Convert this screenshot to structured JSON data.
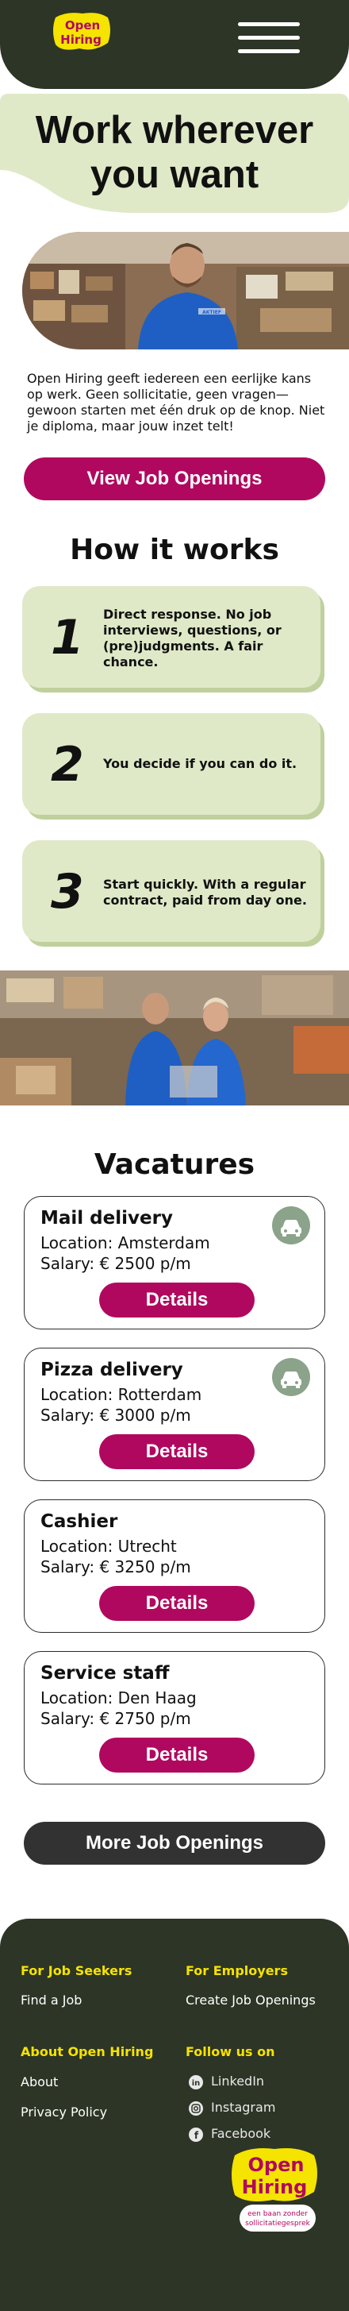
{
  "header": {
    "logo_line1": "Open",
    "logo_line2": "Hiring",
    "menu_icon": "hamburger-menu-icon"
  },
  "hero": {
    "title_line1": "Work wherever",
    "title_line2": "you want",
    "intro": "Open Hiring geeft iedereen een eerlijke kans op werk. Geen sollicitatie, geen vragen—gewoon starten met één druk op de knop. Niet je diploma, maar jouw inzet telt!",
    "cta_label": "View Job Openings",
    "shirt_text": "AKTIEF"
  },
  "how": {
    "title": "How it works",
    "steps": [
      {
        "num": "1",
        "text": "Direct response. No job interviews, questions, or (pre)judgments. A fair chance."
      },
      {
        "num": "2",
        "text": "You decide if you can do it."
      },
      {
        "num": "3",
        "text": "Start quickly. With a regular contract, paid from day one."
      }
    ]
  },
  "vacancies": {
    "title": "Vacatures",
    "items": [
      {
        "title": "Mail delivery",
        "location": "Location: Amsterdam",
        "salary": "Salary: € 2500 p/m",
        "button": "Details",
        "icon": "car-icon"
      },
      {
        "title": "Pizza delivery",
        "location": "Location: Rotterdam",
        "salary": "Salary: € 3000 p/m",
        "button": "Details",
        "icon": "car-icon"
      },
      {
        "title": "Cashier",
        "location": "Location: Utrecht",
        "salary": "Salary: € 3250 p/m",
        "button": "Details"
      },
      {
        "title": "Service staff",
        "location": "Location: Den Haag",
        "salary": "Salary: € 2750 p/m",
        "button": "Details"
      }
    ],
    "more_label": "More Job Openings"
  },
  "footer": {
    "seekers_head": "For Job Seekers",
    "seekers_link": "Find a Job",
    "employers_head": "For Employers",
    "employers_link": "Create Job Openings",
    "about_head": "About Open Hiring",
    "about_link": "About",
    "privacy_link": "Privacy Policy",
    "follow_head": "Follow us on",
    "social": [
      {
        "label": "LinkedIn",
        "icon": "linkedin-icon"
      },
      {
        "label": "Instagram",
        "icon": "instagram-icon"
      },
      {
        "label": "Facebook",
        "icon": "facebook-icon"
      }
    ],
    "logo_tagline_1": "een baan zonder",
    "logo_tagline_2": "sollicitatiegesprek"
  },
  "colors": {
    "dark_green": "#2d3526",
    "magenta": "#b0085f",
    "light_green": "#dfe9c7",
    "yellow": "#f5e300",
    "icon_green": "#8aa38a"
  }
}
